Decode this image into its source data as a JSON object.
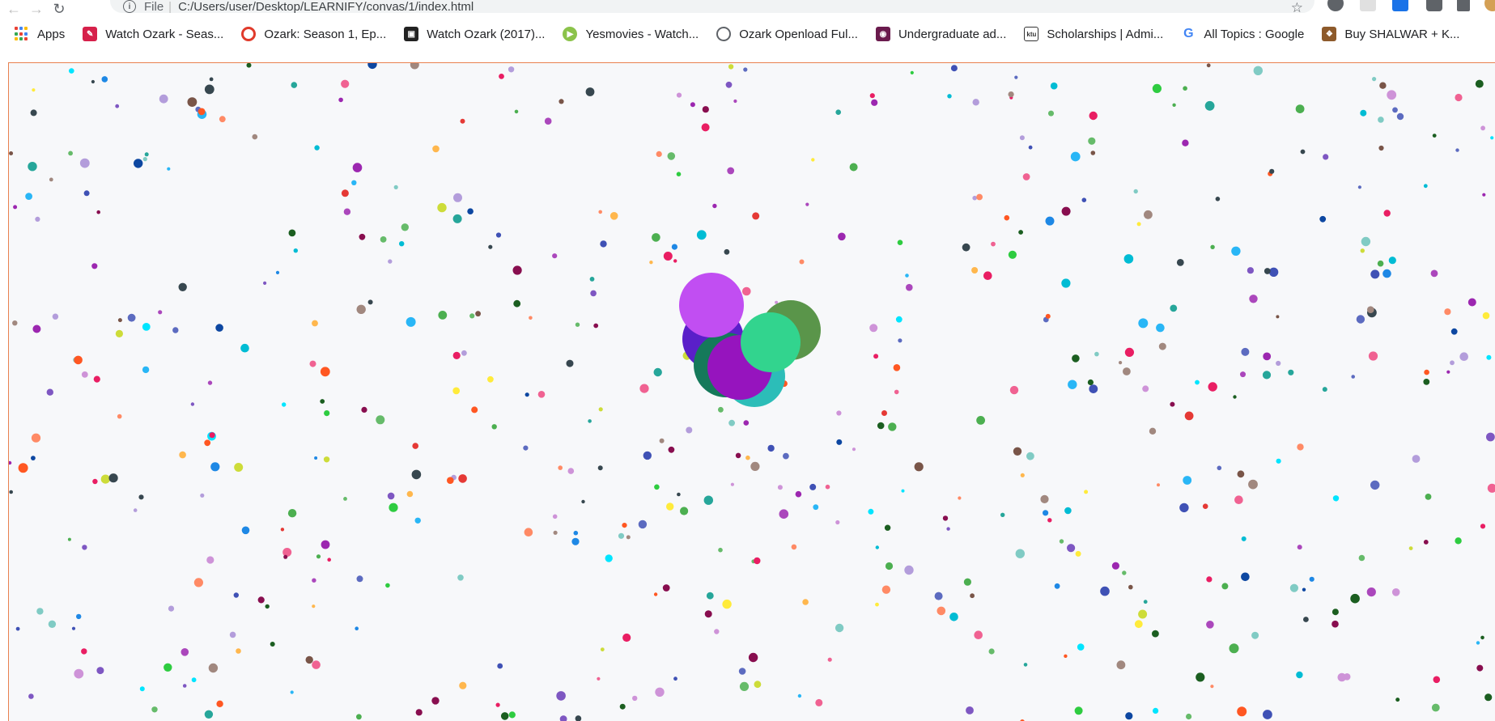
{
  "browser": {
    "address_scheme": "File",
    "address_url": "C:/Users/user/Desktop/LEARNIFY/convas/1/index.html"
  },
  "bookmarks": [
    {
      "label": "Apps",
      "icon": "apps-grid-icon",
      "color": "#ea4335"
    },
    {
      "label": "Watch Ozark - Seas...",
      "icon": "site-icon",
      "color": "#d6204a"
    },
    {
      "label": "Ozark: Season 1, Ep...",
      "icon": "site-icon",
      "color": "#e03a2b"
    },
    {
      "label": "Watch Ozark (2017)...",
      "icon": "clapper-icon",
      "color": "#222222"
    },
    {
      "label": "Yesmovies - Watch...",
      "icon": "play-icon",
      "color": "#8bc34a"
    },
    {
      "label": "Ozark Openload Ful...",
      "icon": "globe-icon",
      "color": "#5f6368"
    },
    {
      "label": "Undergraduate ad...",
      "icon": "site-icon",
      "color": "#6a1b4d"
    },
    {
      "label": "Scholarships | Admi...",
      "icon": "ktu-icon",
      "color": "#333333"
    },
    {
      "label": "All Topics : Google",
      "icon": "google-icon",
      "color": "#4285f4"
    },
    {
      "label": "Buy SHALWAR + K...",
      "icon": "site-icon",
      "color": "#8d5a2b"
    }
  ],
  "canvas": {
    "background": "#f7f8fa",
    "border_color": "#e9804f",
    "small_circle_count": 560,
    "small_radius_range": [
      2,
      6
    ],
    "palette": [
      "#e91e63",
      "#2ecc40",
      "#1e88e5",
      "#9c27b0",
      "#00bcd4",
      "#ff5722",
      "#795548",
      "#cddc39",
      "#3f51b5",
      "#f06292",
      "#26a69a",
      "#ffb74d",
      "#7e57c2",
      "#66bb6a",
      "#e53935",
      "#00e5ff",
      "#5c6bc0",
      "#b39ddb",
      "#a1887f",
      "#ffeb3b",
      "#1b5e20",
      "#880e4f",
      "#0d47a1",
      "#ce93d8",
      "#80cbc4",
      "#ff8a65",
      "#37474f",
      "#ab47bc",
      "#4caf50",
      "#29b6f6"
    ],
    "large_circles": [
      {
        "name": "large-circle-violet",
        "color": "#c14ef2"
      },
      {
        "name": "large-circle-indigo",
        "color": "#5a1fc9"
      },
      {
        "name": "large-circle-olive",
        "color": "#5a954a"
      },
      {
        "name": "large-circle-forest",
        "color": "#15795a"
      },
      {
        "name": "large-circle-teal",
        "color": "#2cbdb8"
      },
      {
        "name": "large-circle-purple",
        "color": "#9614be"
      },
      {
        "name": "large-circle-mint",
        "color": "#32d48e"
      }
    ]
  }
}
